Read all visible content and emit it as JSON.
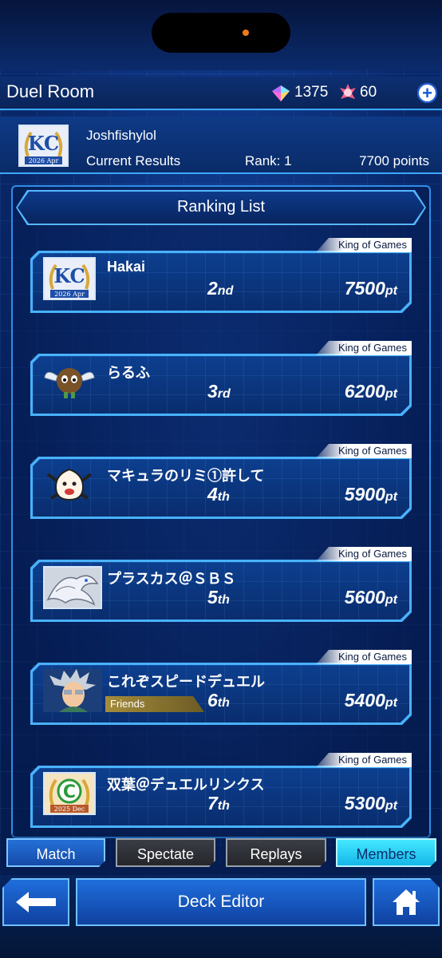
{
  "header": {
    "title": "Duel Room",
    "gems": "1375",
    "orbs": "60",
    "add_label": "+"
  },
  "profile": {
    "name": "Joshfishylol",
    "results_label": "Current Results",
    "rank": "Rank: 1",
    "points": "7700 points",
    "badge_text": "2026 Apr"
  },
  "ranking": {
    "title": "Ranking List",
    "entries": [
      {
        "badge": "King of Games",
        "name": "Hakai",
        "rank_num": "2",
        "rank_suffix": "nd",
        "points": "7500",
        "points_suffix": "pt",
        "avatar": "kc-2026-apr-badge",
        "avatar_text": "2026 Apr"
      },
      {
        "badge": "King of Games",
        "name": "らるふ",
        "rank_num": "3",
        "rank_suffix": "rd",
        "points": "6200",
        "points_suffix": "pt",
        "avatar": "winged-kuriboh"
      },
      {
        "badge": "King of Games",
        "name": "マキュラのリミ①許して",
        "rank_num": "4",
        "rank_suffix": "th",
        "points": "5900",
        "points_suffix": "pt",
        "avatar": "dancing-creature"
      },
      {
        "badge": "King of Games",
        "name": "プラスカス＠ＳＢＳ",
        "rank_num": "5",
        "rank_suffix": "th",
        "points": "5600",
        "points_suffix": "pt",
        "avatar": "blue-eyes-dragon"
      },
      {
        "badge": "King of Games",
        "name": "これぞスピードデュエル",
        "rank_num": "6",
        "rank_suffix": "th",
        "points": "5400",
        "points_suffix": "pt",
        "avatar": "duelist-portrait",
        "tag": "Friends"
      },
      {
        "badge": "King of Games",
        "name": "双葉＠デュエルリンクス",
        "rank_num": "7",
        "rank_suffix": "th",
        "points": "5300",
        "points_suffix": "pt",
        "avatar": "kc-2025-dec-badge",
        "avatar_text": "2025 Dec"
      }
    ]
  },
  "tabs": [
    "Match",
    "Spectate",
    "Replays",
    "Members"
  ],
  "bottom": {
    "deck_editor": "Deck Editor"
  },
  "colors": {
    "accent": "#3aa8ff",
    "active_tab": "#44e8ff",
    "gold": "#d8a83a"
  }
}
